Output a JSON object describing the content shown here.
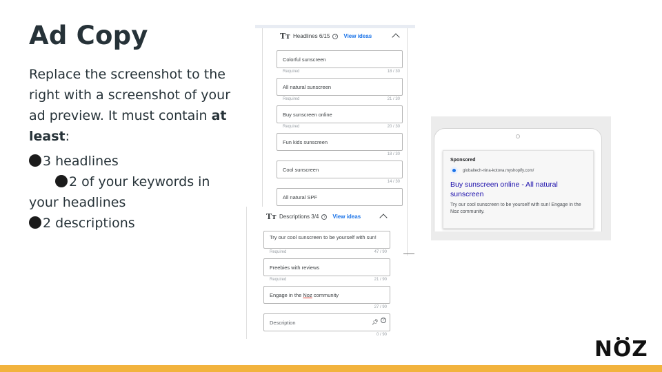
{
  "slide": {
    "title": "Ad Copy",
    "intro_text": "Replace the screenshot to the right with a screenshot of your ad preview. It must contain ",
    "intro_bold": "at least",
    "intro_end": ":",
    "requirements": [
      "3 headlines",
      "2 of your keywords in",
      "your headlines",
      "2 descriptions"
    ],
    "logo_text": "NOZ"
  },
  "headlines_panel": {
    "title": "Headlines 6/15",
    "view_ideas": "View ideas",
    "fields": [
      {
        "value": "Colorful sunscreen",
        "note": "Required",
        "count": "18 / 30"
      },
      {
        "value": "All natural sunscreen",
        "note": "Required",
        "count": "21 / 30"
      },
      {
        "value": "Buy sunscreen online",
        "note": "Required",
        "count": "20 / 30"
      },
      {
        "value": "Fun kids sunscreen",
        "note": "",
        "count": "18 / 30"
      },
      {
        "value": "Cool sunscreen",
        "note": "",
        "count": "14 / 30"
      },
      {
        "value": "All natural SPF",
        "note": "",
        "count": ""
      }
    ]
  },
  "descriptions_panel": {
    "title": "Descriptions 3/4",
    "view_ideas": "View ideas",
    "fields": [
      {
        "value": "Try our cool sunscreen to be yourself with sun!",
        "note": "Required",
        "count": "47 / 90"
      },
      {
        "value": "Freebies with reviews",
        "note": "Required",
        "count": "21 / 90"
      },
      {
        "value_pre": "Engage in the ",
        "value_link": "Noz",
        "value_post": " community",
        "note": "",
        "count": "27 / 90"
      },
      {
        "placeholder": "Description",
        "note": "",
        "count": "0 / 90"
      }
    ]
  },
  "ad_preview": {
    "sponsored": "Sponsored",
    "domain": "globaltech-nina-kotova.myshopify.com/",
    "headline": "Buy sunscreen online - All natural sunscreen",
    "description": "Try our cool sunscreen to be yourself with sun! Engage in the Noz community."
  },
  "colors": {
    "title_text": "#263238",
    "link_blue": "#1a73e8",
    "ad_headline": "#1a0dab",
    "footer_bar": "#f2b33d"
  }
}
